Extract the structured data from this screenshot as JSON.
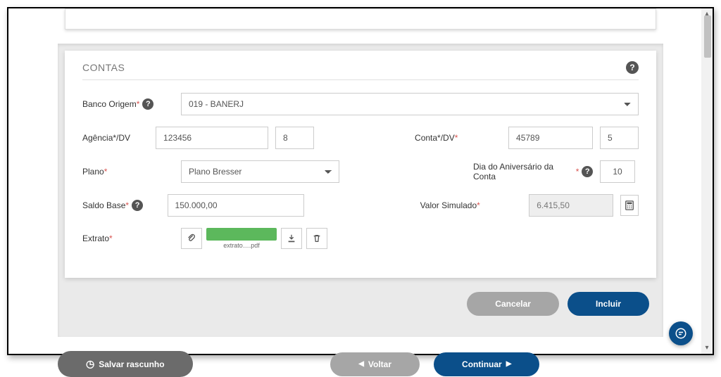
{
  "panel": {
    "title": "CONTAS",
    "labels": {
      "banco_origem": "Banco Origem ",
      "agencia_dv": "Agência*/DV",
      "conta_dv": "Conta*/DV",
      "plano": "Plano",
      "dia_aniversario": "Dia do Aniversário da Conta",
      "saldo_base": "Saldo Base",
      "valor_simulado": "Valor Simulado",
      "extrato": "Extrato"
    },
    "values": {
      "banco_origem": "019 - BANERJ",
      "agencia": "123456",
      "agencia_dv": "8",
      "conta": "45789",
      "conta_dv": "5",
      "plano": "Plano Bresser",
      "dia_aniversario": "10",
      "saldo_base": "150.000,00",
      "valor_simulado": "6.415,50",
      "extrato_filename": "extrato….pdf"
    }
  },
  "buttons": {
    "cancelar": "Cancelar",
    "incluir": "Incluir",
    "salvar_rascunho": "Salvar rascunho",
    "voltar": "Voltar",
    "continuar": "Continuar"
  }
}
